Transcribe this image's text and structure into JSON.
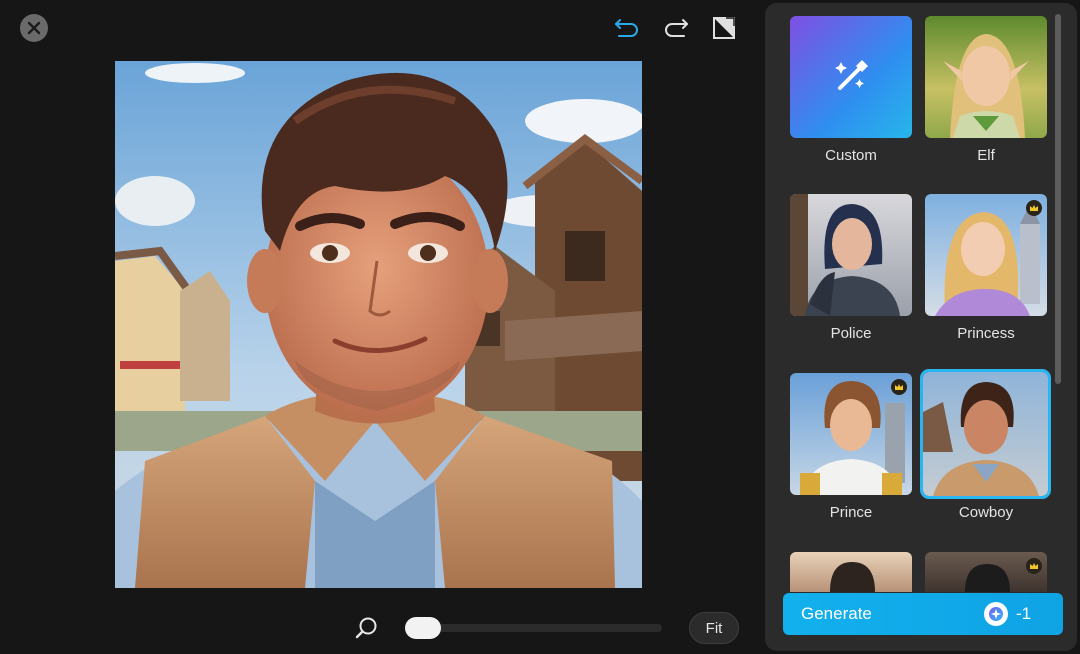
{
  "toolbar": {
    "close_icon": "close-icon",
    "undo_icon": "undo-icon",
    "redo_icon": "redo-icon",
    "compare_icon": "compare-icon",
    "undo_color": "#29a9e6"
  },
  "canvas": {
    "image_description_icon": "portrait-image"
  },
  "bottom_bar": {
    "zoom_icon": "zoom-icon",
    "zoom_level": 0.0,
    "fit_label": "Fit"
  },
  "styles": {
    "items": [
      {
        "label": "Custom",
        "premium": false,
        "selected": false
      },
      {
        "label": "Elf",
        "premium": false,
        "selected": false
      },
      {
        "label": "Police",
        "premium": false,
        "selected": false
      },
      {
        "label": "Princess",
        "premium": true,
        "selected": false
      },
      {
        "label": "Prince",
        "premium": true,
        "selected": false
      },
      {
        "label": "Cowboy",
        "premium": false,
        "selected": true
      },
      {
        "label": "",
        "premium": false,
        "selected": false
      },
      {
        "label": "",
        "premium": true,
        "selected": false
      }
    ]
  },
  "generate": {
    "label": "Generate",
    "cost": "-1",
    "accent": "#13b0ee"
  }
}
